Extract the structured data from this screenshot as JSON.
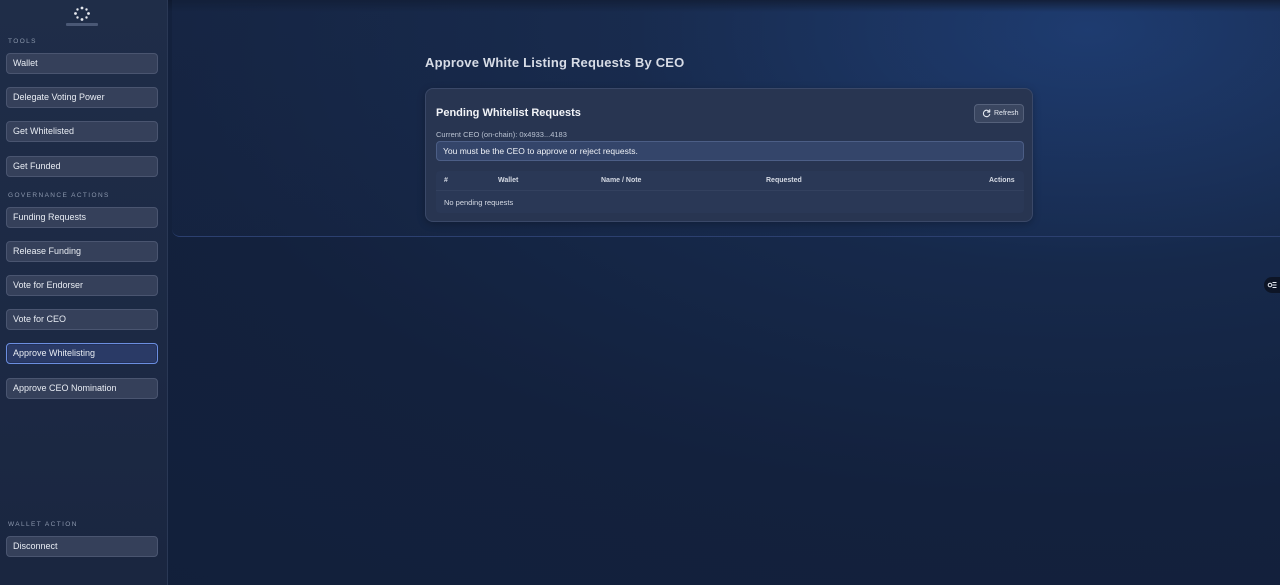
{
  "sidebar": {
    "logo_icon": "logo-icon",
    "tools_label": "TOOLS",
    "tools": [
      {
        "label": "Wallet"
      },
      {
        "label": "Delegate Voting Power"
      },
      {
        "label": "Get Whitelisted"
      },
      {
        "label": "Get Funded"
      }
    ],
    "governance_label": "GOVERNANCE ACTIONS",
    "governance": [
      {
        "label": "Funding Requests"
      },
      {
        "label": "Release Funding"
      },
      {
        "label": "Vote for Endorser"
      },
      {
        "label": "Vote for CEO"
      },
      {
        "label": "Approve Whitelisting",
        "active": true
      },
      {
        "label": "Approve CEO Nomination"
      }
    ],
    "wallet_action_label": "WALLET ACTION",
    "disconnect_label": "Disconnect"
  },
  "main": {
    "page_title": "Approve White Listing Requests By CEO",
    "card": {
      "title": "Pending Whitelist Requests",
      "refresh_label": "Refresh",
      "refresh_icon": "refresh-icon",
      "ceo_line": "Current CEO (on-chain): 0x4933...4183",
      "notice": "You must be the CEO to approve or reject requests.",
      "table": {
        "columns": [
          "#",
          "Wallet",
          "Name / Note",
          "Requested",
          "Actions"
        ],
        "empty_text": "No pending requests"
      }
    }
  },
  "floating_toggle_icon": "settings-toggle-icon",
  "colors": {
    "background": "#13213d",
    "sidebar": "#1f2d48",
    "card": "#283551",
    "accent_active": "#6b8ee0"
  }
}
